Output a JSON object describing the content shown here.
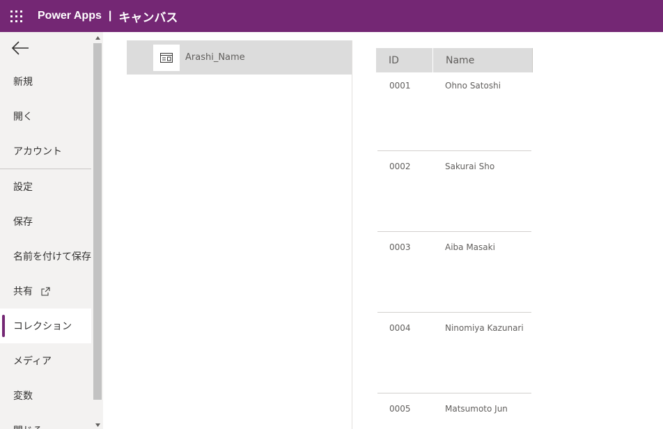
{
  "header": {
    "app_name": "Power Apps",
    "separator": "|",
    "subtitle": "キャンバス",
    "bg_color": "#742774"
  },
  "nav": {
    "back_icon": "back-arrow-icon",
    "items": [
      {
        "label": "新規"
      },
      {
        "label": "開く"
      },
      {
        "label": "アカウント"
      },
      {
        "label": "設定"
      },
      {
        "label": "保存"
      },
      {
        "label": "名前を付けて保存"
      },
      {
        "label": "共有",
        "icon": "external-link-icon"
      },
      {
        "label": "コレクション",
        "active": true
      },
      {
        "label": "メディア"
      },
      {
        "label": "変数"
      },
      {
        "label": "閉じる"
      }
    ]
  },
  "collections": {
    "items": [
      {
        "name": "Arashi_Name",
        "icon": "table-icon"
      }
    ]
  },
  "table": {
    "headers": {
      "id": "ID",
      "name": "Name"
    },
    "rows": [
      {
        "id": "0001",
        "name": "Ohno Satoshi"
      },
      {
        "id": "0002",
        "name": "Sakurai Sho"
      },
      {
        "id": "0003",
        "name": "Aiba Masaki"
      },
      {
        "id": "0004",
        "name": "Ninomiya Kazunari"
      },
      {
        "id": "0005",
        "name": "Matsumoto Jun"
      }
    ]
  }
}
